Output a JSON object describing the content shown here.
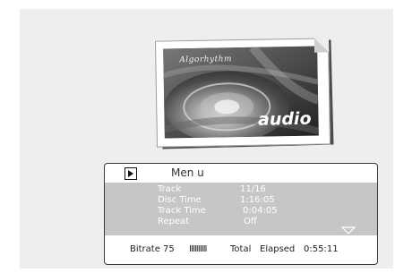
{
  "album": {
    "brand": "Algorhythm",
    "word": "audio"
  },
  "panel": {
    "menu_label": "Men u",
    "info": [
      {
        "label": "Track",
        "value": "11/16"
      },
      {
        "label": "Disc Time",
        "value": "1:16:05"
      },
      {
        "label": "Track Time",
        "value": "0:04:05"
      },
      {
        "label": "Repeat",
        "value": "Off"
      }
    ],
    "status": {
      "bitrate_label": "Bitrate 75",
      "bitrate_meter": "IIIIIIIIII",
      "total_label": "Total",
      "elapsed_label": "Elapsed",
      "elapsed_value": "0:55:11"
    }
  },
  "icons": {
    "play": "play-icon",
    "down_arrow": "down-arrow-icon"
  }
}
